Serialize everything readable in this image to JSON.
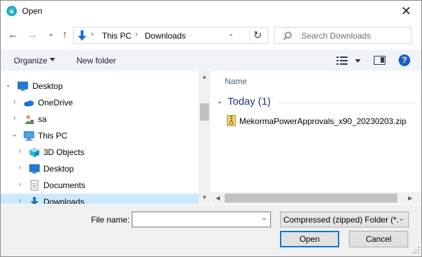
{
  "window": {
    "title": "Open",
    "close_glyph": "✕"
  },
  "nav": {
    "back_glyph": "←",
    "forward_glyph": "→",
    "recent_glyph": "⌄",
    "up_glyph": "↑"
  },
  "address": {
    "crumbs": [
      "This PC",
      "Downloads"
    ],
    "separator": "›",
    "dropdown_glyph": "⌄",
    "refresh_glyph": "↻"
  },
  "search": {
    "placeholder": "Search Downloads"
  },
  "toolbar": {
    "organize_label": "Organize",
    "new_folder_label": "New folder",
    "help_glyph": "?"
  },
  "tree": {
    "items": [
      {
        "label": "Desktop",
        "chevron": "⌄",
        "icon": "desktop-blue-icon"
      },
      {
        "label": "OneDrive",
        "chevron": "›",
        "icon": "onedrive-cloud-icon"
      },
      {
        "label": "sa",
        "chevron": "›",
        "icon": "user-icon"
      },
      {
        "label": "This PC",
        "chevron": "⌄",
        "icon": "computer-icon"
      },
      {
        "label": "3D Objects",
        "chevron": "›",
        "icon": "cube-icon"
      },
      {
        "label": "Desktop",
        "chevron": "›",
        "icon": "desktop-icon"
      },
      {
        "label": "Documents",
        "chevron": "›",
        "icon": "document-icon"
      },
      {
        "label": "Downloads",
        "chevron": "›",
        "icon": "download-arrow-icon"
      }
    ]
  },
  "scrollbar": {
    "up_glyph": "▲",
    "down_glyph": "▼",
    "left_glyph": "◀",
    "right_glyph": "▶"
  },
  "list": {
    "column_name": "Name",
    "group_chevron": "⌄",
    "group_label": "Today (1)",
    "files": [
      {
        "name": "MekormaPowerApprovals_x90_20230203.zip",
        "icon": "zip-folder-icon"
      }
    ]
  },
  "footer": {
    "file_name_label": "File name:",
    "file_name_value": "",
    "file_name_drop": "⌄",
    "file_type_value": "Compressed (zipped) Folder (*.",
    "file_type_drop": "⌄",
    "open_label": "Open",
    "cancel_label": "Cancel"
  },
  "colors": {
    "accent": "#0078d7",
    "selected_row": "#cce8ff",
    "group_header": "#1e3287",
    "command_bar": "#f0f4f9"
  }
}
